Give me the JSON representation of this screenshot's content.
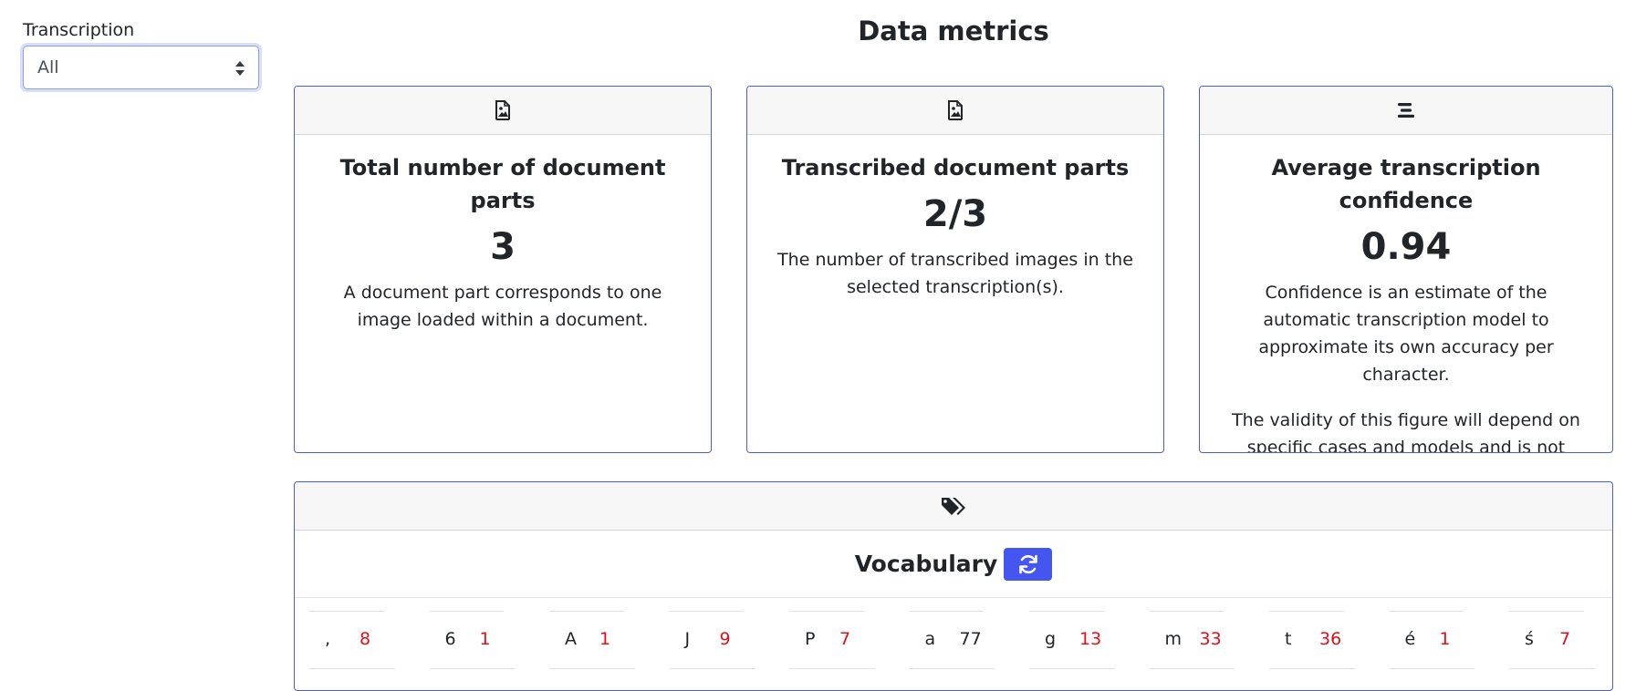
{
  "filter": {
    "label": "Transcription",
    "selected": "All"
  },
  "page_title": "Data metrics",
  "cards": [
    {
      "icon": "document-image-icon",
      "title": "Total number of document parts",
      "value": "3",
      "texts": [
        "A document part corresponds to one image loaded within a document."
      ]
    },
    {
      "icon": "document-image-icon",
      "title": "Transcribed document parts",
      "value": "2/3",
      "texts": [
        "The number of transcribed images in the selected transcription(s)."
      ]
    },
    {
      "icon": "align-lines-icon",
      "title": "Average transcription confidence",
      "value": "0.94",
      "texts": [
        "Confidence is an estimate of the automatic transcription model to approximate its own accuracy per character.",
        "The validity of this figure will depend on specific cases and models and is not necessarily an indication of result quality."
      ]
    }
  ],
  "vocabulary": {
    "icon": "tags-icon",
    "title": "Vocabulary",
    "refresh_icon": "refresh-icon",
    "accent": "#4455f0",
    "items": [
      {
        "char": ",",
        "count": "8",
        "highlight": true
      },
      {
        "char": "6",
        "count": "1",
        "highlight": true
      },
      {
        "char": "A",
        "count": "1",
        "highlight": true
      },
      {
        "char": "J",
        "count": "9",
        "highlight": true
      },
      {
        "char": "P",
        "count": "7",
        "highlight": true
      },
      {
        "char": "a",
        "count": "77",
        "highlight": false
      },
      {
        "char": "g",
        "count": "13",
        "highlight": true
      },
      {
        "char": "m",
        "count": "33",
        "highlight": true
      },
      {
        "char": "t",
        "count": "36",
        "highlight": true
      },
      {
        "char": "é",
        "count": "1",
        "highlight": true
      },
      {
        "char": "ś",
        "count": "7",
        "highlight": true
      }
    ]
  }
}
